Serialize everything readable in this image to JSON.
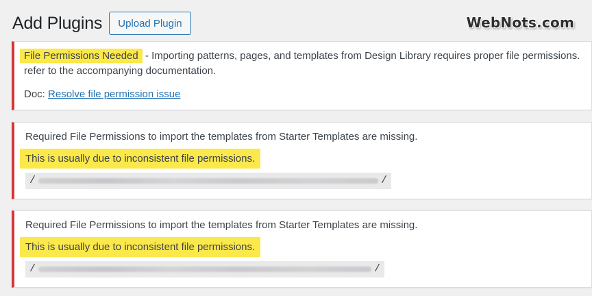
{
  "header": {
    "title": "Add Plugins",
    "upload_button": "Upload Plugin"
  },
  "watermark": "WebNots.com",
  "notice1": {
    "highlight": "File Permissions Needed",
    "text_after": " - Importing patterns, pages, and templates from Design Library requires proper file permissions.",
    "line2": "refer to the accompanying documentation.",
    "doc_label": "Doc: ",
    "doc_link": "Resolve file permission issue"
  },
  "notice2": {
    "line1": "Required File Permissions to import the templates from Starter Templates are missing.",
    "highlight": "This is usually due to inconsistent file permissions.",
    "path_start": "/",
    "path_end": "/"
  },
  "notice3": {
    "line1": "Required File Permissions to import the templates from Starter Templates are missing.",
    "highlight": "This is usually due to inconsistent file permissions.",
    "path_start": "/",
    "path_end": "/"
  },
  "colors": {
    "error_border": "#d63638",
    "link": "#2271b1",
    "highlight": "#fbe84a",
    "background": "#f0f0f1"
  }
}
